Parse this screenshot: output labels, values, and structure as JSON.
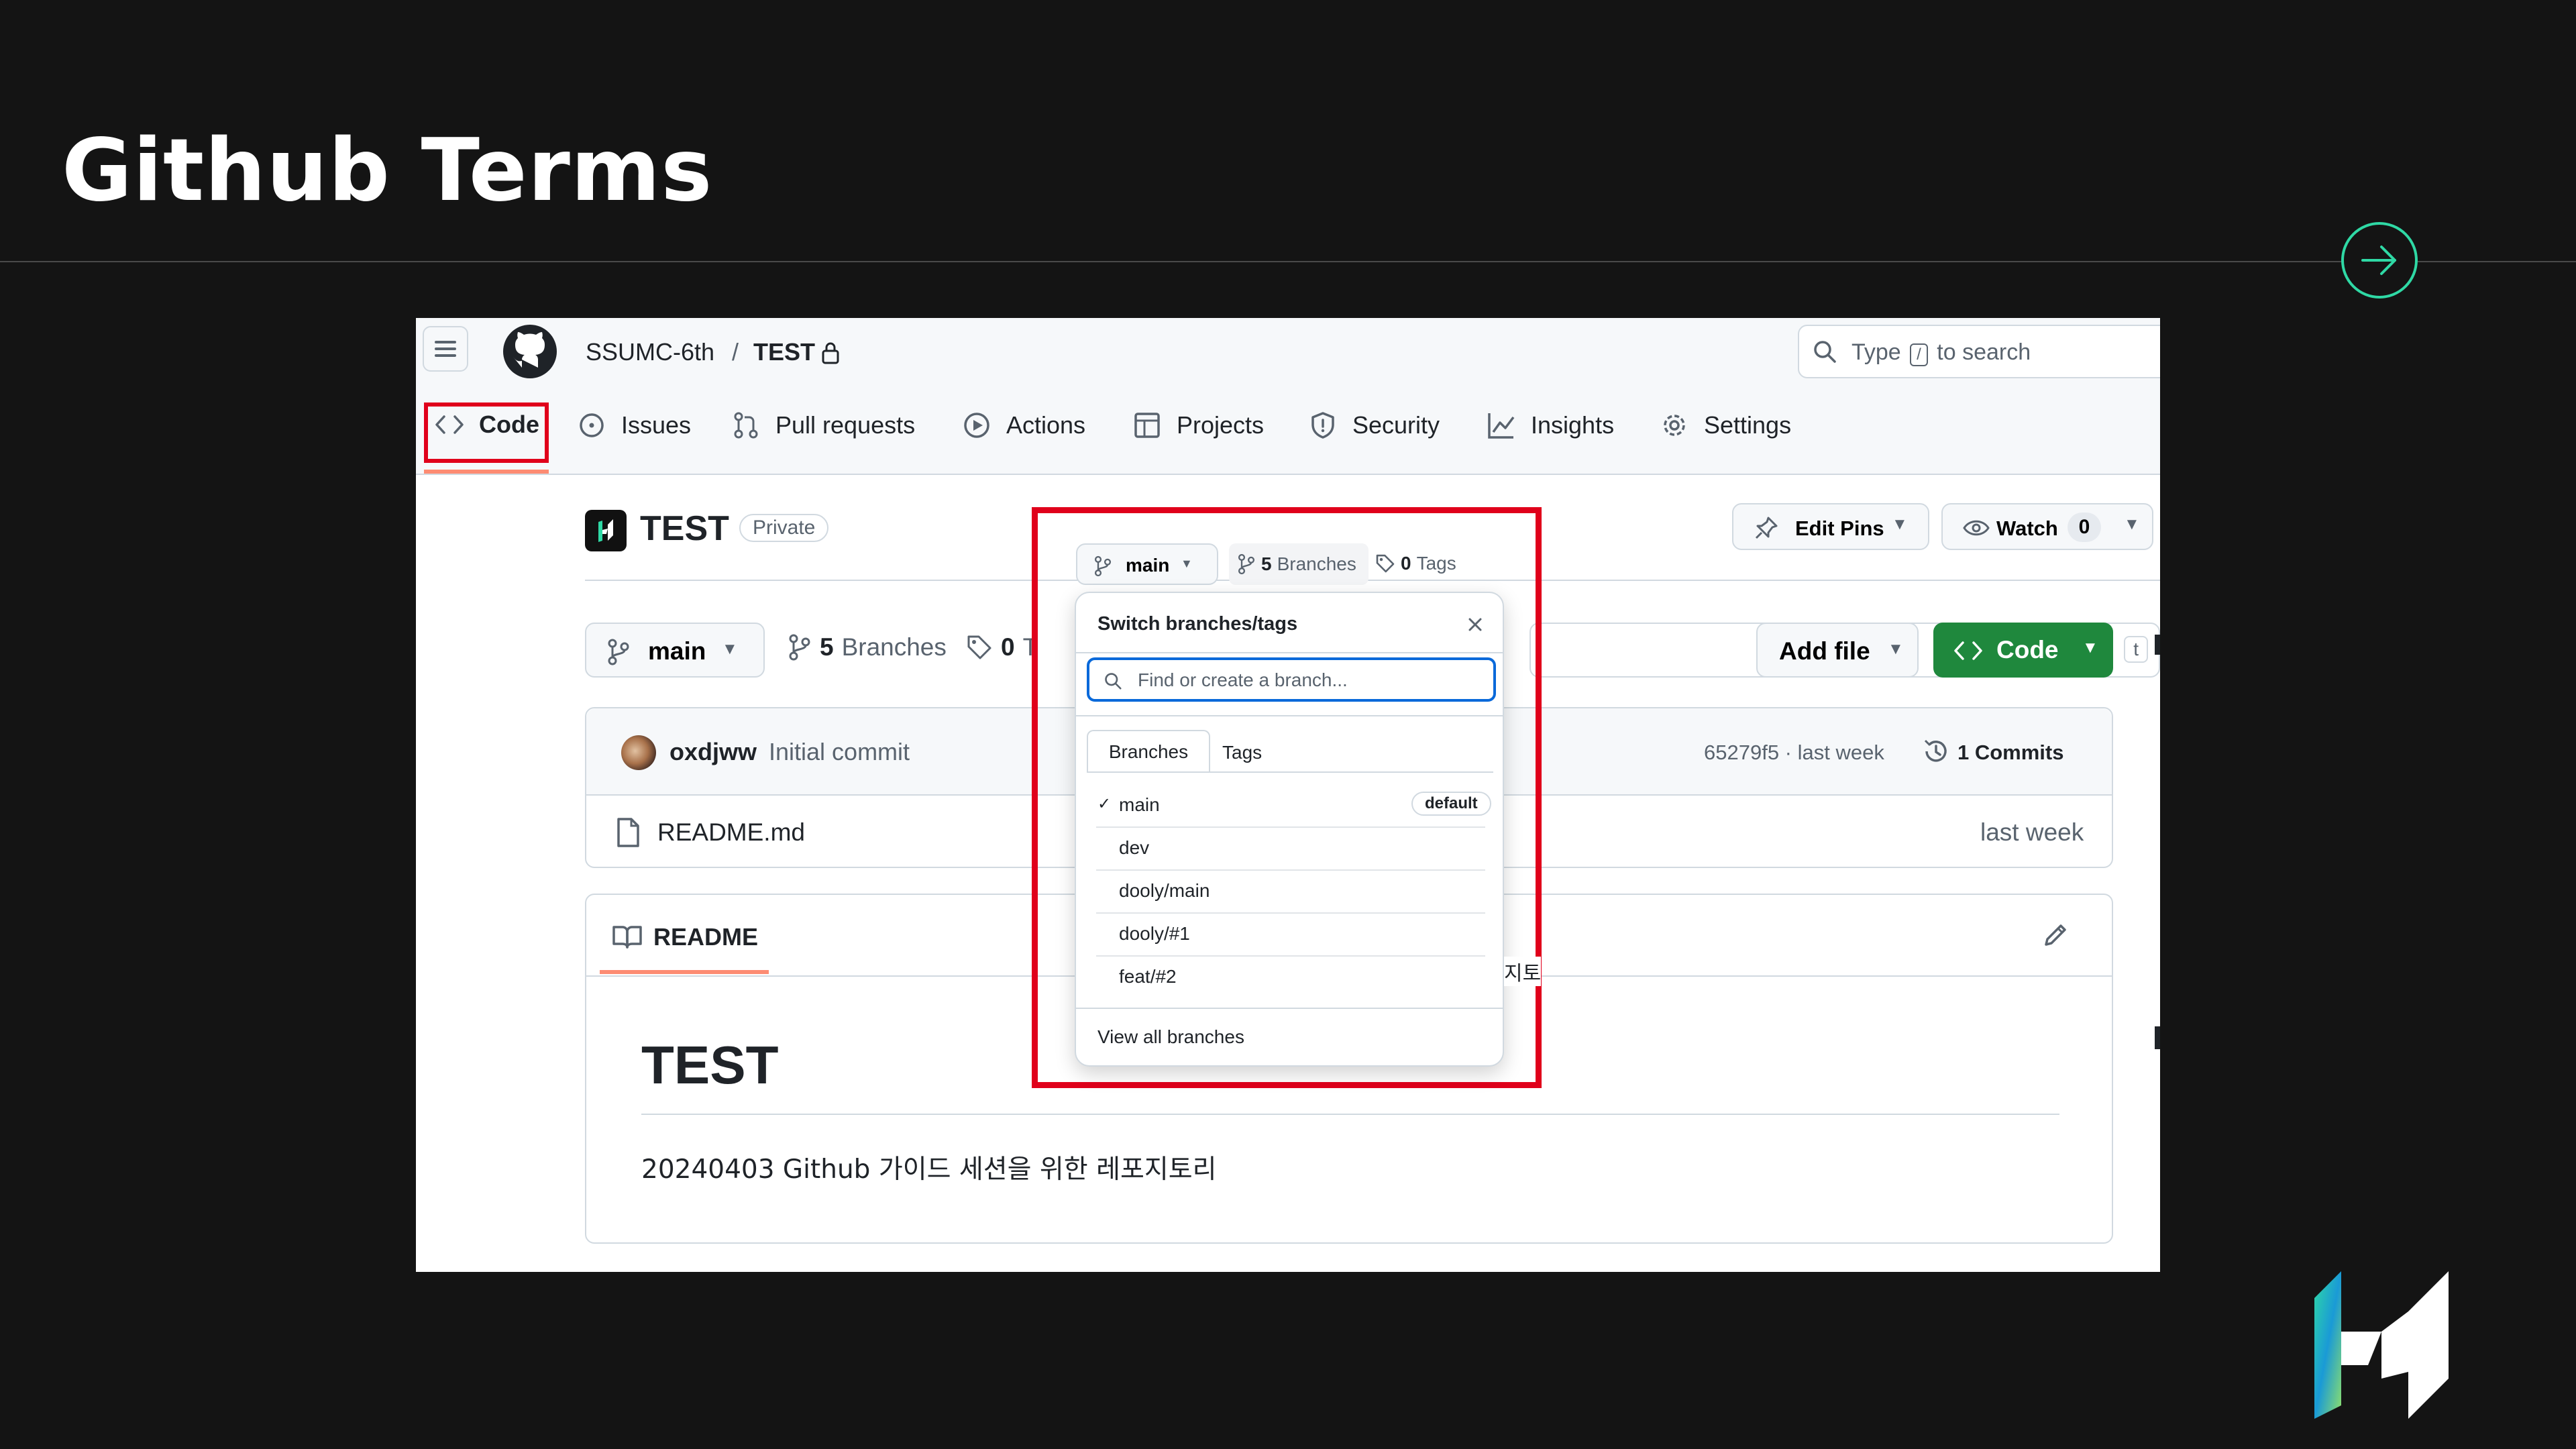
{
  "slide": {
    "title": "Github Terms",
    "accent_color": "#2fd9a5",
    "next_icon": "arrow-right-icon",
    "logo_icon": "brand-logo"
  },
  "github": {
    "owner": "SSUMC-6th",
    "separator": "/",
    "repo": "TEST",
    "lock_icon": "lock-icon",
    "search_prefix": "Type",
    "search_key": "/",
    "search_suffix": "to search",
    "tabs": [
      {
        "label": "Code",
        "icon": "code-icon"
      },
      {
        "label": "Issues",
        "icon": "issue-icon"
      },
      {
        "label": "Pull requests",
        "icon": "pull-request-icon"
      },
      {
        "label": "Actions",
        "icon": "play-icon"
      },
      {
        "label": "Projects",
        "icon": "table-icon"
      },
      {
        "label": "Security",
        "icon": "shield-icon"
      },
      {
        "label": "Insights",
        "icon": "graph-icon"
      },
      {
        "label": "Settings",
        "icon": "gear-icon"
      }
    ],
    "repo_title": "TEST",
    "visibility": "Private",
    "edit_pins": "Edit Pins",
    "watch": "Watch",
    "watch_count": "0",
    "branch_button": "main",
    "branches_count": "5",
    "branches_word": "Branches",
    "tags_count": "0",
    "tags_word_cut": "T",
    "go_to_file_key": "t",
    "add_file": "Add file",
    "code_button": "Code",
    "commit_author": "oxdjww",
    "commit_message": "Initial commit",
    "commit_hash": "65279f5 · last week",
    "commits_label": "1 Commits",
    "file_name": "README.md",
    "file_time": "last week",
    "readme_tab": "README",
    "readme_heading": "TEST",
    "readme_text": "20240403 Github 가이드 세션을 위한 레포지토리",
    "readme_peek": "지토"
  },
  "dropdown": {
    "branch_button": "main",
    "branches_count": "5",
    "branches_word": "Branches",
    "tags_count": "0",
    "tags_word": "Tags",
    "title": "Switch branches/tags",
    "close_icon": "close-icon",
    "search_placeholder": "Find or create a branch...",
    "tabs": [
      {
        "label": "Branches",
        "active": true
      },
      {
        "label": "Tags",
        "active": false
      }
    ],
    "branches": [
      {
        "name": "main",
        "checked": true,
        "badge": "default"
      },
      {
        "name": "dev",
        "checked": false,
        "badge": ""
      },
      {
        "name": "dooly/main",
        "checked": false,
        "badge": ""
      },
      {
        "name": "dooly/#1",
        "checked": false,
        "badge": ""
      },
      {
        "name": "feat/#2",
        "checked": false,
        "badge": ""
      }
    ],
    "view_all": "View all branches"
  },
  "highlight_color": "#e0001b"
}
